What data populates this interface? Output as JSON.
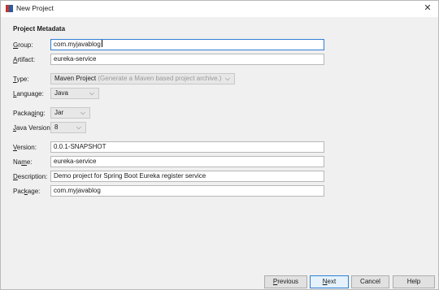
{
  "window": {
    "title": "New Project"
  },
  "section": {
    "title": "Project Metadata"
  },
  "fields": {
    "group": {
      "label_u": "G",
      "label_rest": "roup:",
      "value": "com.myjavablog"
    },
    "artifact": {
      "label_u": "A",
      "label_rest": "rtifact:",
      "value": "eureka-service"
    },
    "type": {
      "label_u": "T",
      "label_rest": "ype:",
      "value": "Maven Project",
      "hint": "(Generate a Maven based project archive.)"
    },
    "language": {
      "label_u": "L",
      "label_rest": "anguage:",
      "value": "Java"
    },
    "packaging": {
      "label_pre": "Packag",
      "label_u": "i",
      "label_rest": "ng:",
      "value": "Jar"
    },
    "java_version": {
      "label_u": "J",
      "label_rest": "ava Version:",
      "value": "8"
    },
    "version": {
      "label_u": "V",
      "label_rest": "ersion:",
      "value": "0.0.1-SNAPSHOT"
    },
    "name": {
      "label_pre": "Na",
      "label_u": "m",
      "label_rest": "e:",
      "value": "eureka-service"
    },
    "description": {
      "label_u": "D",
      "label_rest": "escription:",
      "value": "Demo project for Spring Boot Eureka register service"
    },
    "package": {
      "label_pre": "Pac",
      "label_u": "k",
      "label_rest": "age:",
      "value": "com.myjavablog"
    }
  },
  "buttons": {
    "previous": {
      "u": "P",
      "rest": "revious"
    },
    "next": {
      "u": "N",
      "rest": "ext"
    },
    "cancel": "Cancel",
    "help": "Help"
  },
  "icons": {
    "app": "intellij-app-icon",
    "close": "close-icon",
    "chevron": "chevron-down-icon"
  },
  "colors": {
    "focus_border": "#2f7fd4",
    "window_bg": "#f0f0f0",
    "hint_text": "#9a9a9a"
  }
}
